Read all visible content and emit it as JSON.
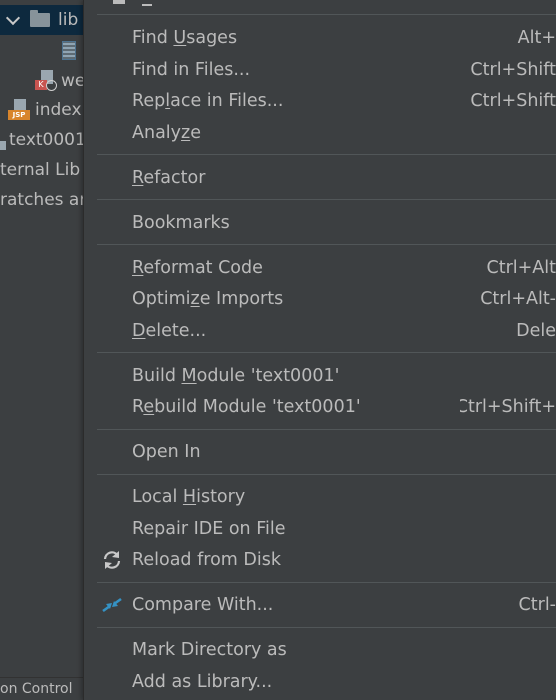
{
  "project_tree": {
    "lib_label": "lib",
    "web_label": "we",
    "index_label": "index",
    "module_label": "text0001",
    "external_libraries": "ternal Lib",
    "scratches": "ratches ar"
  },
  "status_bar": {
    "label": "on Control"
  },
  "menu": {
    "find_usages": {
      "pre": "Find ",
      "key": "U",
      "post": "sages",
      "shortcut": "Alt+"
    },
    "find_in_files": {
      "label": "Find in Files...",
      "shortcut": "Ctrl+Shift"
    },
    "replace_in_files": {
      "pre": "Rep",
      "key": "l",
      "post": "ace in Files...",
      "shortcut": "Ctrl+Shift"
    },
    "analyze": {
      "pre": "Analy",
      "key": "z",
      "post": "e"
    },
    "refactor": {
      "pre": "",
      "key": "R",
      "post": "efactor"
    },
    "bookmarks": {
      "label": "Bookmarks"
    },
    "reformat_code": {
      "pre": "",
      "key": "R",
      "post": "eformat Code",
      "shortcut": "Ctrl+Alt"
    },
    "optimize_imports": {
      "pre": "Optimi",
      "key": "z",
      "post": "e Imports",
      "shortcut": "Ctrl+Alt-"
    },
    "delete": {
      "pre": "",
      "key": "D",
      "post": "elete...",
      "shortcut": "Dele"
    },
    "build_module": {
      "pre": "Build ",
      "key": "M",
      "post": "odule 'text0001'"
    },
    "rebuild_module": {
      "pre": "R",
      "key": "e",
      "post": "build Module 'text0001'",
      "shortcut": "Ctrl+Shift+"
    },
    "open_in": {
      "label": "Open In"
    },
    "local_history": {
      "pre": "Local ",
      "key": "H",
      "post": "istory"
    },
    "repair_ide": {
      "label": "Repair IDE on File"
    },
    "reload_from_disk": {
      "label": "Reload from Disk",
      "icon": "reload-icon"
    },
    "compare_with": {
      "label": "Compare With...",
      "shortcut": "Ctrl-",
      "icon": "compare-icon"
    },
    "mark_directory": {
      "label": "Mark Directory as"
    },
    "add_as_library": {
      "label": "Add as Library..."
    }
  },
  "colors": {
    "menu_bg": "#3c3f41",
    "text": "#bbbbbb",
    "separator": "#515658",
    "selection": "#0d293e",
    "compare_icon_blue": "#3592c4"
  }
}
